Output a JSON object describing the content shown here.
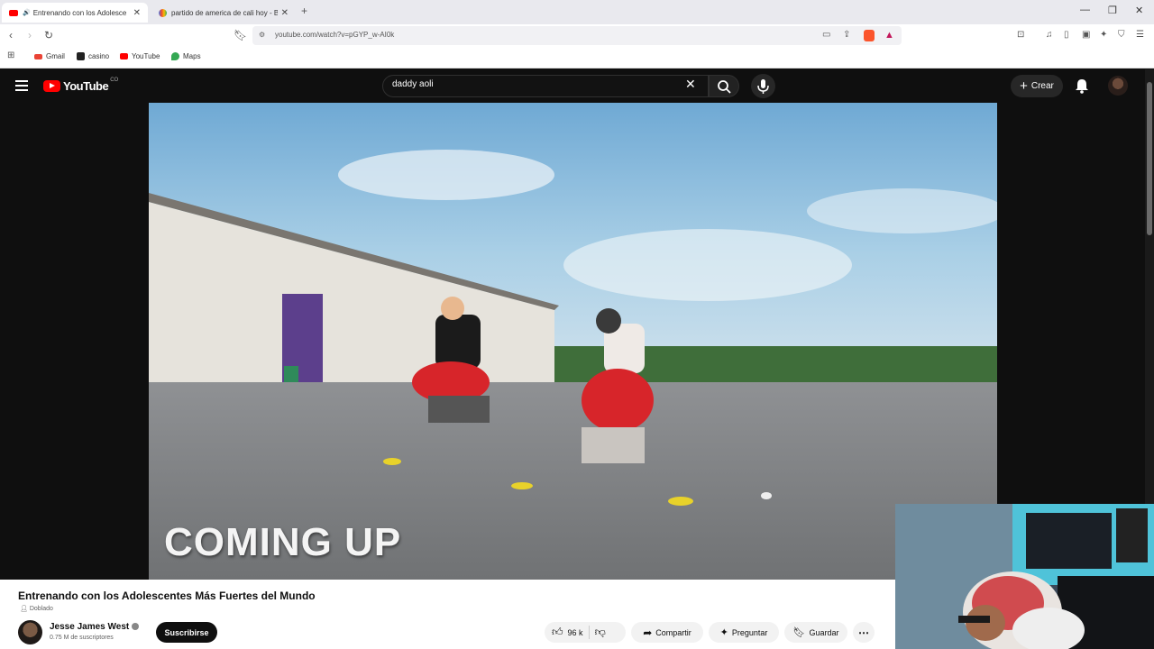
{
  "browser": {
    "tabs": [
      {
        "title": "Entrenando con los Adolesce",
        "favicon": "youtube-favicon",
        "active": true
      },
      {
        "title": "partido de america de cali hoy - Busc",
        "favicon": "google-favicon",
        "active": false
      }
    ],
    "url": "youtube.com/watch?v=pGYP_w-AI0k",
    "bookmarks": [
      {
        "label": "Gmail",
        "icon": "gmail-icon"
      },
      {
        "label": "casino",
        "icon": "bookmark-s-icon"
      },
      {
        "label": "YouTube",
        "icon": "youtube-icon"
      },
      {
        "label": "Maps",
        "icon": "maps-icon"
      }
    ]
  },
  "header": {
    "logo_text": "YouTube",
    "country_code": "CO",
    "search_value": "daddy aoli",
    "create_label": "Crear"
  },
  "video": {
    "overlay_text": "COMING UP"
  },
  "info": {
    "title": "Entrenando con los Adolescentes Más Fuertes del Mundo",
    "dubbed_label": "Doblado",
    "channel_name": "Jesse James West",
    "subscribers": "0.75 M de suscriptores",
    "subscribe_label": "Suscribirse",
    "likes": "96 k",
    "share_label": "Compartir",
    "ask_label": "Preguntar",
    "save_label": "Guardar"
  },
  "colors": {
    "youtube_red": "#ff0000",
    "header_bg": "#0f0f0f",
    "pill_bg": "#f2f2f2"
  }
}
